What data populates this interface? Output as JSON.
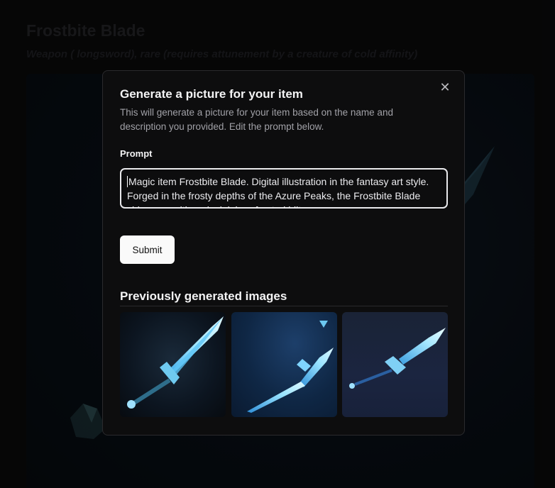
{
  "background": {
    "title": "Frostbite Blade",
    "subtitle": "Weapon ( longsword), rare (requires attunement by a creature of cold affinity)"
  },
  "modal": {
    "title": "Generate a picture for your item",
    "description": "This will generate a picture for your item based on the name and description you provided. Edit the prompt below.",
    "close_icon": "close-icon",
    "prompt_label": "Prompt",
    "prompt_value": "Magic item Frostbite Blade. Digital illustration in the fantasy art style. Forged in the frosty depths of the Azure Peaks, the Frostbite Blade shimmers with a glacial, hoarfrosted hilt...",
    "submit_label": "Submit",
    "previous_title": "Previously generated images",
    "thumbnails": [
      {
        "alt": "frost sword image 1"
      },
      {
        "alt": "frost sword image 2"
      },
      {
        "alt": "frost sword image 3"
      }
    ]
  },
  "colors": {
    "accent_ice": "#7fd4ff",
    "modal_bg": "#0d0d0e",
    "button_bg": "#fafafa"
  }
}
